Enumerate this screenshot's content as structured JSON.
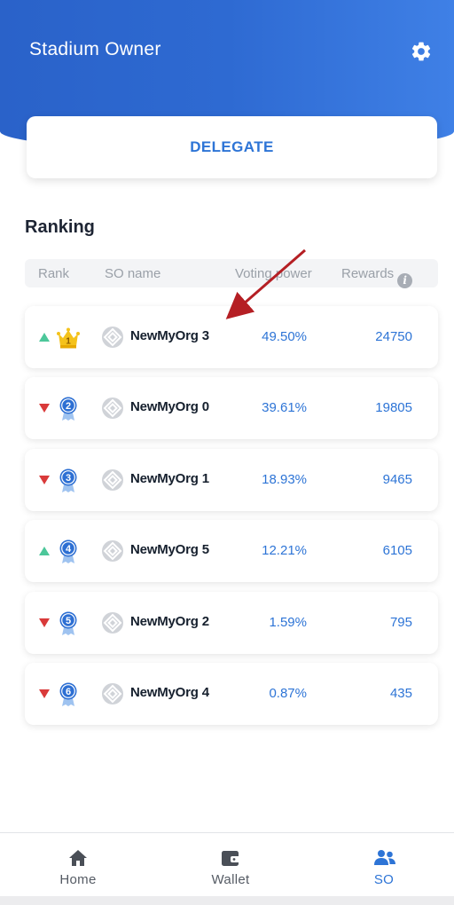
{
  "header": {
    "title": "Stadium Owner",
    "settings_icon": "gear-icon"
  },
  "delegate": {
    "label": "DELEGATE"
  },
  "ranking": {
    "title": "Ranking",
    "columns": {
      "rank": "Rank",
      "name": "SO name",
      "voting": "Voting power",
      "rewards": "Rewards",
      "info_icon": "i"
    },
    "rows": [
      {
        "trend": "up",
        "rank": "1",
        "name": "NewMyOrg 3",
        "voting": "49.50%",
        "rewards": "24750"
      },
      {
        "trend": "down",
        "rank": "2",
        "name": "NewMyOrg 0",
        "voting": "39.61%",
        "rewards": "19805"
      },
      {
        "trend": "down",
        "rank": "3",
        "name": "NewMyOrg 1",
        "voting": "18.93%",
        "rewards": "9465"
      },
      {
        "trend": "up",
        "rank": "4",
        "name": "NewMyOrg 5",
        "voting": "12.21%",
        "rewards": "6105"
      },
      {
        "trend": "down",
        "rank": "5",
        "name": "NewMyOrg 2",
        "voting": "1.59%",
        "rewards": "795"
      },
      {
        "trend": "down",
        "rank": "6",
        "name": "NewMyOrg 4",
        "voting": "0.87%",
        "rewards": "435"
      }
    ]
  },
  "nav": {
    "home": "Home",
    "wallet": "Wallet",
    "so": "SO",
    "active": "so"
  },
  "colors": {
    "header": "#2e6ad2",
    "accent": "#2d74d6",
    "trend_up": "#4cc79a",
    "trend_down": "#d93a3a",
    "annotation_arrow": "#b51f24"
  }
}
